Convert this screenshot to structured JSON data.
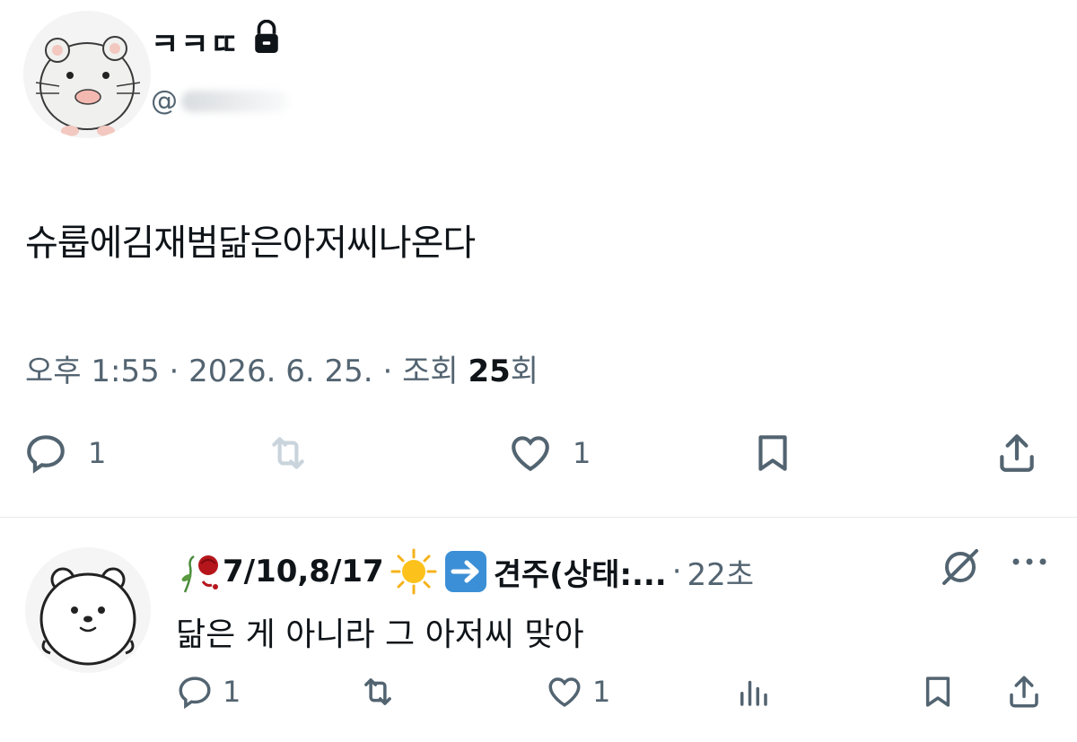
{
  "tweet": {
    "display_name": "ㅋㅋㄸ",
    "handle_prefix": "@",
    "text": "슈룹에김재범닮은아저씨나온다",
    "time": "오후 1:55",
    "date": "2026. 6. 25.",
    "views_label": "조회",
    "views_count": "25",
    "views_suffix": "회",
    "separator": "·",
    "replies": "1",
    "likes": "1"
  },
  "reply": {
    "name": "7/10,8/17",
    "name_tail": "견주(상태:...",
    "separator": "·",
    "time": "22초",
    "text": "닮은 게 아니라 그 아저씨 맞아",
    "replies": "1",
    "likes": "1"
  },
  "icons": [
    "hamster-avatar",
    "lock-icon",
    "reply-icon",
    "retweet-icon",
    "like-icon",
    "bookmark-icon",
    "share-icon",
    "bear-avatar",
    "wilted-rose-icon",
    "sun-icon",
    "arrow-right-icon",
    "grok-icon",
    "more-icon",
    "views-icon"
  ],
  "colors": {
    "text": "#0f1419",
    "secondary": "#536471",
    "divider": "#e6e9eb",
    "retweet_disabled": "#c9d4dc"
  }
}
